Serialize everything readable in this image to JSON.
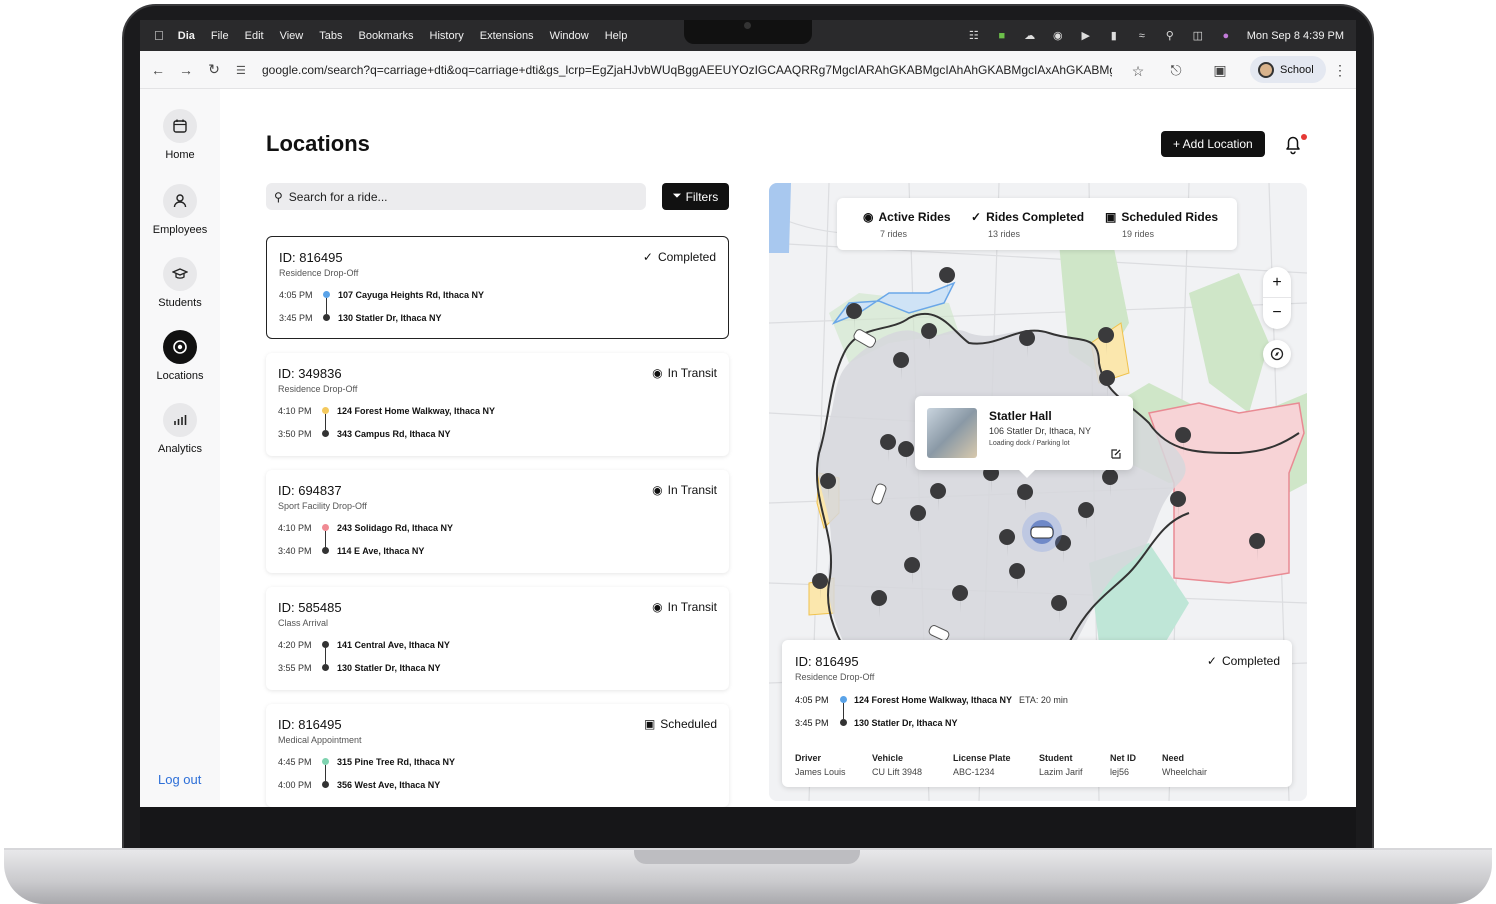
{
  "menubar": {
    "app": "Dia",
    "items": [
      "File",
      "Edit",
      "View",
      "Tabs",
      "Bookmarks",
      "History",
      "Extensions",
      "Window",
      "Help"
    ],
    "clock": "Mon Sep 8  4:39 PM"
  },
  "browser": {
    "url": "google.com/search?q=carriage+dti&oq=carriage+dti&gs_lcrp=EgZjaHJvbWUqBggAEEUYOzIGCAAQRRg7MgcIARAhGKABMgcIAhAhGKABMgcIAxAhGKABMgc...",
    "profile": "School"
  },
  "sidebar": {
    "items": [
      {
        "label": "Home",
        "icon": "calendar-icon"
      },
      {
        "label": "Employees",
        "icon": "user-icon"
      },
      {
        "label": "Students",
        "icon": "graduation-cap-icon"
      },
      {
        "label": "Locations",
        "icon": "location-pin-icon"
      },
      {
        "label": "Analytics",
        "icon": "chart-icon"
      }
    ],
    "active": "Locations",
    "logout": "Log out"
  },
  "header": {
    "title": "Locations",
    "add_button": "+ Add Location"
  },
  "search": {
    "placeholder": "Search for a ride...",
    "filters_label": "Filters"
  },
  "rides": [
    {
      "id": "ID: 816495",
      "type": "Residence Drop-Off",
      "status": "Completed",
      "status_icon": "check-circle-icon",
      "time1": "4:05 PM",
      "addr1": "107 Cayuga Heights Rd, Ithaca NY",
      "time2": "3:45 PM",
      "addr2": "130 Statler Dr, Ithaca NY",
      "dot": "#5aa3e8"
    },
    {
      "id": "ID: 349836",
      "type": "Residence Drop-Off",
      "status": "In Transit",
      "status_icon": "transit-icon",
      "time1": "4:10 PM",
      "addr1": "124 Forest Home Walkway, Ithaca NY",
      "time2": "3:50 PM",
      "addr2": "343 Campus Rd, Ithaca NY",
      "dot": "#f4c95d"
    },
    {
      "id": "ID: 694837",
      "type": "Sport Facility Drop-Off",
      "status": "In Transit",
      "status_icon": "transit-icon",
      "time1": "4:10 PM",
      "addr1": "243 Solidago Rd, Ithaca NY",
      "time2": "3:40 PM",
      "addr2": "114 E Ave, Ithaca NY",
      "dot": "#f08a93"
    },
    {
      "id": "ID: 585485",
      "type": "Class Arrival",
      "status": "In Transit",
      "status_icon": "transit-icon",
      "time1": "4:20 PM",
      "addr1": "141 Central Ave, Ithaca NY",
      "time2": "3:55 PM",
      "addr2": "130 Statler Dr, Ithaca NY",
      "dot": "#333333"
    },
    {
      "id": "ID: 816495",
      "type": "Medical Appointment",
      "status": "Scheduled",
      "status_icon": "calendar-icon",
      "time1": "4:45 PM",
      "addr1": "315 Pine Tree Rd, Ithaca NY",
      "time2": "4:00 PM",
      "addr2": "356 West Ave, Ithaca NY",
      "dot": "#7fd3b0"
    }
  ],
  "map": {
    "stats": [
      {
        "label": "Active Rides",
        "sub": "7 rides",
        "icon": "transit-icon"
      },
      {
        "label": "Rides Completed",
        "sub": "13 rides",
        "icon": "check-circle-icon"
      },
      {
        "label": "Scheduled Rides",
        "sub": "19 rides",
        "icon": "calendar-icon"
      }
    ],
    "popup": {
      "name": "Statler Hall",
      "address": "106 Statler Dr, Ithaca, NY",
      "detail": "Loading dock / Parking lot"
    },
    "zoom_in": "+",
    "zoom_out": "−"
  },
  "detail": {
    "id": "ID: 816495",
    "type": "Residence Drop-Off",
    "status": "Completed",
    "time1": "4:05 PM",
    "addr1": "124 Forest Home Walkway, Ithaca NY",
    "eta": "ETA: 20 min",
    "time2": "3:45 PM",
    "addr2": "130 Statler Dr, Ithaca NY",
    "meta": [
      {
        "k": "Driver",
        "v": "James Louis"
      },
      {
        "k": "Vehicle",
        "v": "CU Lift 3948"
      },
      {
        "k": "License Plate",
        "v": "ABC-1234"
      },
      {
        "k": "Student",
        "v": "Lazim Jarif"
      },
      {
        "k": "Net ID",
        "v": "lej56"
      },
      {
        "k": "Need",
        "v": "Wheelchair"
      }
    ]
  },
  "colors": {
    "accent": "#111111",
    "link": "#2d6fd8",
    "notification": "#e53935"
  }
}
